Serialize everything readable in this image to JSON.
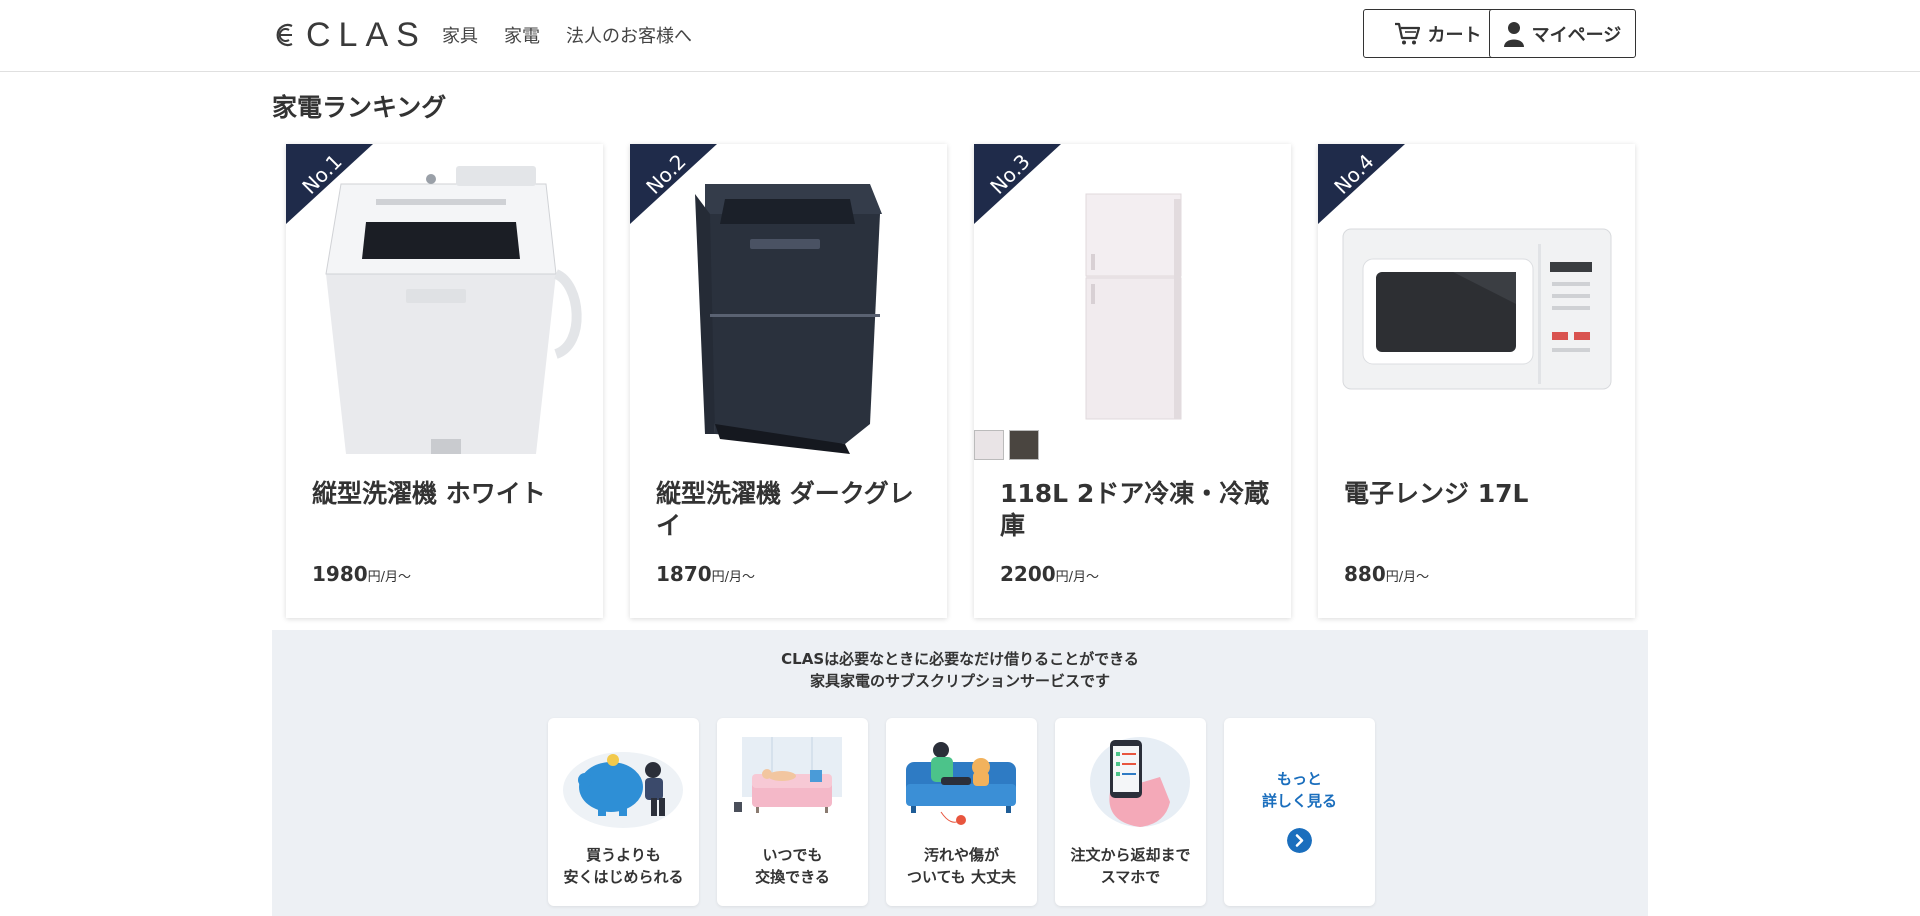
{
  "header": {
    "logo_text": "CLAS",
    "nav": [
      "家具",
      "家電",
      "法人のお客様へ"
    ],
    "cart_label": "カート",
    "mypage_label": "マイページ"
  },
  "section_title": "家電ランキング",
  "products": [
    {
      "rank": "No.1",
      "name": "縦型洗濯機 ホワイト",
      "price": "1980",
      "unit": "円/月〜"
    },
    {
      "rank": "No.2",
      "name": "縦型洗濯機 ダークグレイ",
      "price": "1870",
      "unit": "円/月〜"
    },
    {
      "rank": "No.3",
      "name": "118L 2ドア冷凍・冷蔵庫",
      "price": "2200",
      "unit": "円/月〜",
      "swatches": [
        "#e9e4e6",
        "#4a4540"
      ]
    },
    {
      "rank": "No.4",
      "name": "電子レンジ 17L",
      "price": "880",
      "unit": "円/月〜"
    }
  ],
  "about": {
    "line1": "CLASは必要なときに必要なだけ借りることができる",
    "line2": "家具家電のサブスクリプションサービスです",
    "features": [
      {
        "label": "買うよりも\n安くはじめられる",
        "icon": "piggy-bank-illustration"
      },
      {
        "label": "いつでも\n交換できる",
        "icon": "sofa-illustration"
      },
      {
        "label": "汚れや傷が\nついても 大丈夫",
        "icon": "couch-cat-illustration"
      },
      {
        "label": "注文から返却まで\nスマホで",
        "icon": "smartphone-illustration"
      }
    ],
    "more_label": "もっと\n詳しく見る"
  },
  "colors": {
    "badge": "#1f2b4a",
    "about_bg": "#edf0f4",
    "accent_blue": "#1a6ebd"
  }
}
